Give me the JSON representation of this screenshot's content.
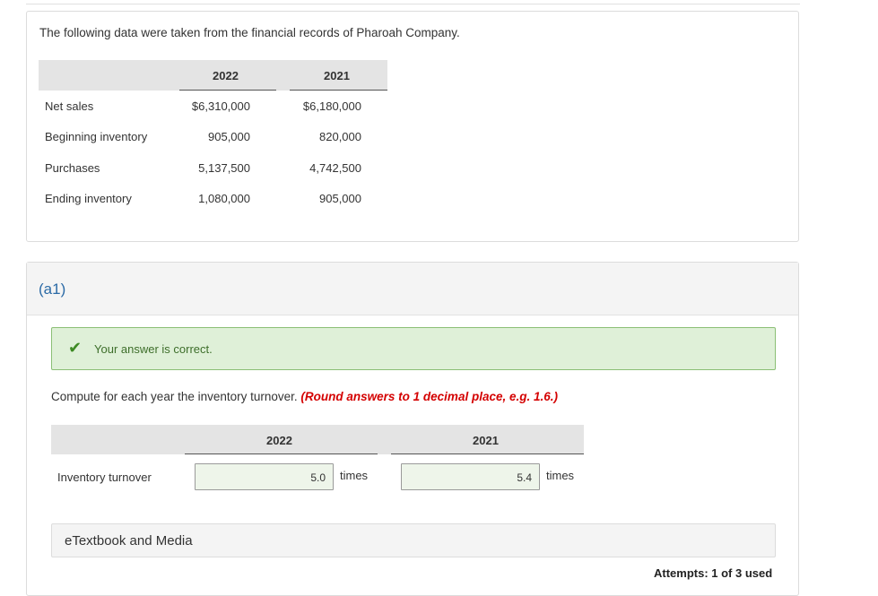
{
  "intro": "The following data were taken from the financial records of Pharoah Company.",
  "table1": {
    "years": [
      "2022",
      "2021"
    ],
    "rows": [
      {
        "label": "Net sales",
        "v2022": "$6,310,000",
        "v2021": "$6,180,000"
      },
      {
        "label": "Beginning inventory",
        "v2022": "905,000",
        "v2021": "820,000"
      },
      {
        "label": "Purchases",
        "v2022": "5,137,500",
        "v2021": "4,742,500"
      },
      {
        "label": "Ending inventory",
        "v2022": "1,080,000",
        "v2021": "905,000"
      }
    ]
  },
  "part": {
    "label": "(a1)",
    "feedback": "Your answer is correct.",
    "instruction": "Compute for each year the inventory turnover. ",
    "instruction_note": "(Round answers to 1 decimal place, e.g. 1.6.)",
    "years": [
      "2022",
      "2021"
    ],
    "row_label": "Inventory turnover",
    "answers": [
      "5.0",
      "5.4"
    ],
    "unit": "times",
    "etextbook": "eTextbook and Media",
    "attempts": "Attempts: 1 of 3 used"
  },
  "colors": {
    "correct_bg": "#dff0d8",
    "check": "#3d8a23",
    "note": "#d40000",
    "part_label": "#2b6aa6"
  }
}
